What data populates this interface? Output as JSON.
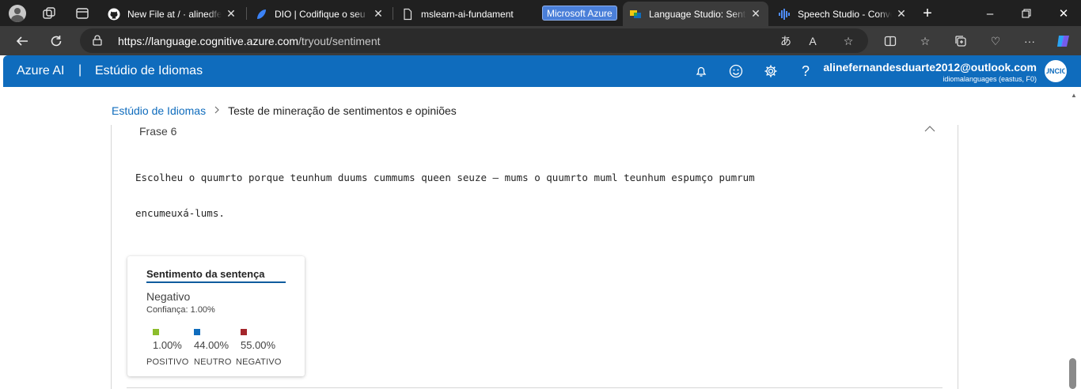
{
  "browser": {
    "tabs": [
      {
        "title": "New File at / · alinedfer",
        "icon": "github-icon"
      },
      {
        "title": "DIO | Codifique o seu f",
        "icon": "dio-icon"
      },
      {
        "title": "mslearn-ai-fundament",
        "icon": "document-icon"
      },
      {
        "title": "Language Studio: Sent",
        "icon": "language-studio-icon",
        "active": true
      },
      {
        "title": "Speech Studio - Conve",
        "icon": "speech-studio-icon"
      }
    ],
    "tab_group_label": "Microsoft Azure",
    "url_host": "https://language.cognitive.azure.com",
    "url_path": "/tryout/sentiment",
    "colors": {
      "tabstrip": "#202020",
      "toolbar": "#3b3b3b",
      "group": "#4a7fd9"
    }
  },
  "header": {
    "brand": "Azure AI",
    "separator": "|",
    "product": "Estúdio de Idiomas",
    "account_email": "alinefernandesduarte2012@outlook.com",
    "account_resource": "idiomalanguages (eastus, F0)",
    "avatar_text": "UNCIO",
    "accent_color": "#0f6cbd"
  },
  "breadcrumb": {
    "root": "Estúdio de Idiomas",
    "current": "Teste de mineração de sentimentos e opiniões"
  },
  "sentence": {
    "heading": "Frase 6",
    "text_line1": "Escolheu o quumrto porque teunhum duums cummums queen seuze – mums o quumrto muml teunhum espumço pumrum",
    "text_line2": "encumeuxá-lums."
  },
  "sentiment_card": {
    "title": "Sentimento da sentença",
    "value": "Negativo",
    "confidence": "Confiança: 1.00%",
    "scores": [
      {
        "label": "POSITIVO",
        "percent": "1.00%",
        "color": "#8cbd2c"
      },
      {
        "label": "NEUTRO",
        "percent": "44.00%",
        "color": "#0f6cbd"
      },
      {
        "label": "NEGATIVO",
        "percent": "55.00%",
        "color": "#a4262c"
      }
    ]
  }
}
